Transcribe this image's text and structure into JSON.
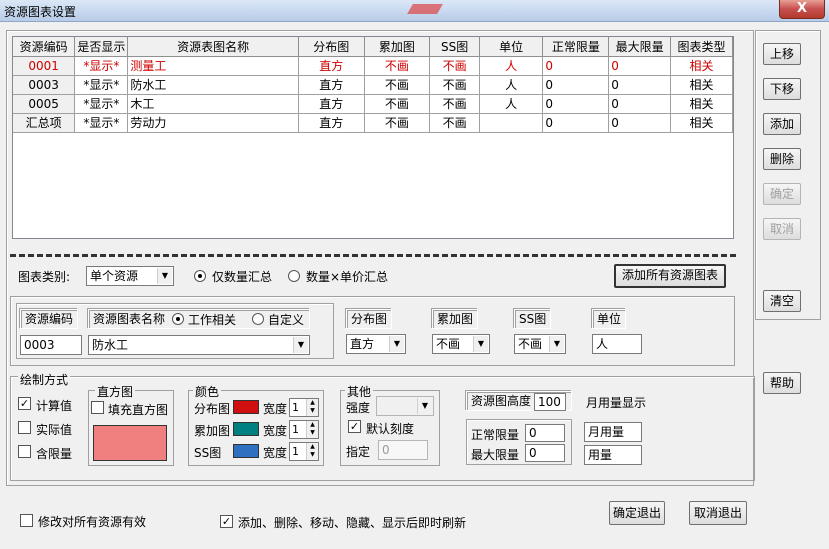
{
  "window": {
    "title": "资源图表设置",
    "close": "X"
  },
  "grid": {
    "headers": [
      "资源编码",
      "是否显示",
      "资源表图名称",
      "分布图",
      "累加图",
      "SS图",
      "单位",
      "正常限量",
      "最大限量",
      "图表类型"
    ],
    "rows": [
      [
        "0001",
        "*显示*",
        "测量工",
        "直方",
        "不画",
        "不画",
        "人",
        "0",
        "0",
        "相关"
      ],
      [
        "0003",
        "*显示*",
        "防水工",
        "直方",
        "不画",
        "不画",
        "人",
        "0",
        "0",
        "相关"
      ],
      [
        "0005",
        "*显示*",
        "木工",
        "直方",
        "不画",
        "不画",
        "人",
        "0",
        "0",
        "相关"
      ],
      [
        "汇总项",
        "*显示*",
        "劳动力",
        "直方",
        "不画",
        "不画",
        "",
        "0",
        "0",
        "相关"
      ]
    ]
  },
  "side_buttons": {
    "up": "上移",
    "down": "下移",
    "add": "添加",
    "delete": "删除",
    "confirm": "确定",
    "cancel": "取消",
    "clear": "清空",
    "help": "帮助"
  },
  "chart_type": {
    "label": "图表类别:",
    "value": "单个资源",
    "radio_qty": "仅数量汇总",
    "radio_price": "数量×单价汇总",
    "add_all": "添加所有资源图表"
  },
  "resource": {
    "code_label": "资源编码",
    "code_value": "0003",
    "name_label": "资源图表名称",
    "radio_work": "工作相关",
    "radio_custom": "自定义",
    "name_value": "防水工",
    "dist_label": "分布图",
    "dist_value": "直方",
    "cum_label": "累加图",
    "cum_value": "不画",
    "ss_label": "SS图",
    "ss_value": "不画",
    "unit_label": "单位",
    "unit_value": "人"
  },
  "draw": {
    "title": "绘制方式",
    "calc": "计算值",
    "actual": "实际值",
    "limit": "含限量",
    "hist_title": "直方图",
    "fill": "填充直方图",
    "hist_color": "#f08080"
  },
  "colors": {
    "title": "颜色",
    "dist": "分布图",
    "cum": "累加图",
    "ss": "SS图",
    "width": "宽度",
    "w1": "1",
    "w2": "1",
    "w3": "1",
    "c_dist": "#d01010",
    "c_cum": "#008080",
    "c_ss": "#3070c0"
  },
  "other": {
    "title": "其他",
    "intensity": "强度",
    "default_scale": "默认刻度",
    "specify": "指定",
    "specify_value": "0"
  },
  "limits": {
    "height_label": "资源图高度",
    "height_value": "100",
    "normal_label": "正常限量",
    "normal_value": "0",
    "max_label": "最大限量",
    "max_value": "0",
    "month_display": "月用量显示",
    "month_value": "月用量",
    "usage_value": "用量"
  },
  "footer": {
    "apply_all": "修改对所有资源有效",
    "refresh": "添加、删除、移动、隐藏、显示后即时刷新",
    "ok_exit": "确定退出",
    "cancel_exit": "取消退出"
  }
}
